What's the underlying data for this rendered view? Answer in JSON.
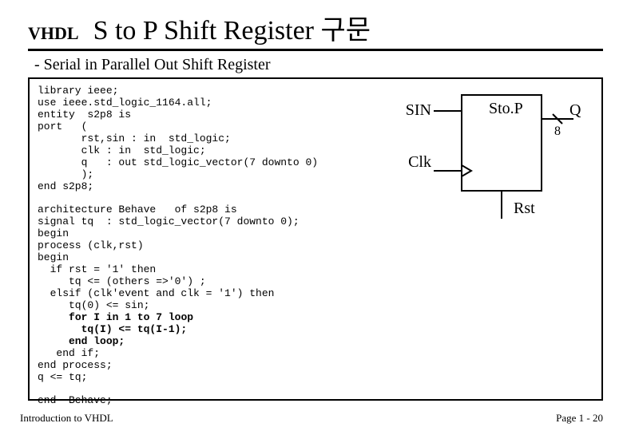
{
  "header": {
    "vhdl_label": "VHDL",
    "title": "S to P Shift Register 구문"
  },
  "subtitle": "- Serial in Parallel Out Shift Register",
  "code": {
    "l01": "library ieee;",
    "l02": "use ieee.std_logic_1164.all;",
    "l03": "entity  s2p8 is",
    "l04": "port   (",
    "l05": "       rst,sin : in  std_logic;",
    "l06": "       clk : in  std_logic;",
    "l07": "       q   : out std_logic_vector(7 downto 0)",
    "l08": "       );",
    "l09": "end s2p8;",
    "l10": "",
    "l11": "architecture Behave   of s2p8 is",
    "l12": "signal tq  : std_logic_vector(7 downto 0);",
    "l13": "begin",
    "l14": "process (clk,rst)",
    "l15": "begin",
    "l16": "  if rst = '1' then",
    "l17": "     tq <= (others =>'0') ;",
    "l18": "  elsif (clk'event and clk = '1') then",
    "l19": "     tq(0) <= sin;",
    "l20a": "     ",
    "l20b": "for I in 1 to 7 loop",
    "l21": "       tq(I) <= tq(I-1);",
    "l22": "     end loop;",
    "l23": "   end if;",
    "l24": "end process;",
    "l25": "q <= tq;",
    "l26": "",
    "l27": "end  Behave;"
  },
  "diagram": {
    "block_label": "Sto.P",
    "sin_label": "SIN",
    "q_label": "Q",
    "bus_width": "8",
    "clk_label": "Clk",
    "rst_label": "Rst"
  },
  "footer": {
    "left": "Introduction to VHDL",
    "right": "Page 1 -  20"
  }
}
